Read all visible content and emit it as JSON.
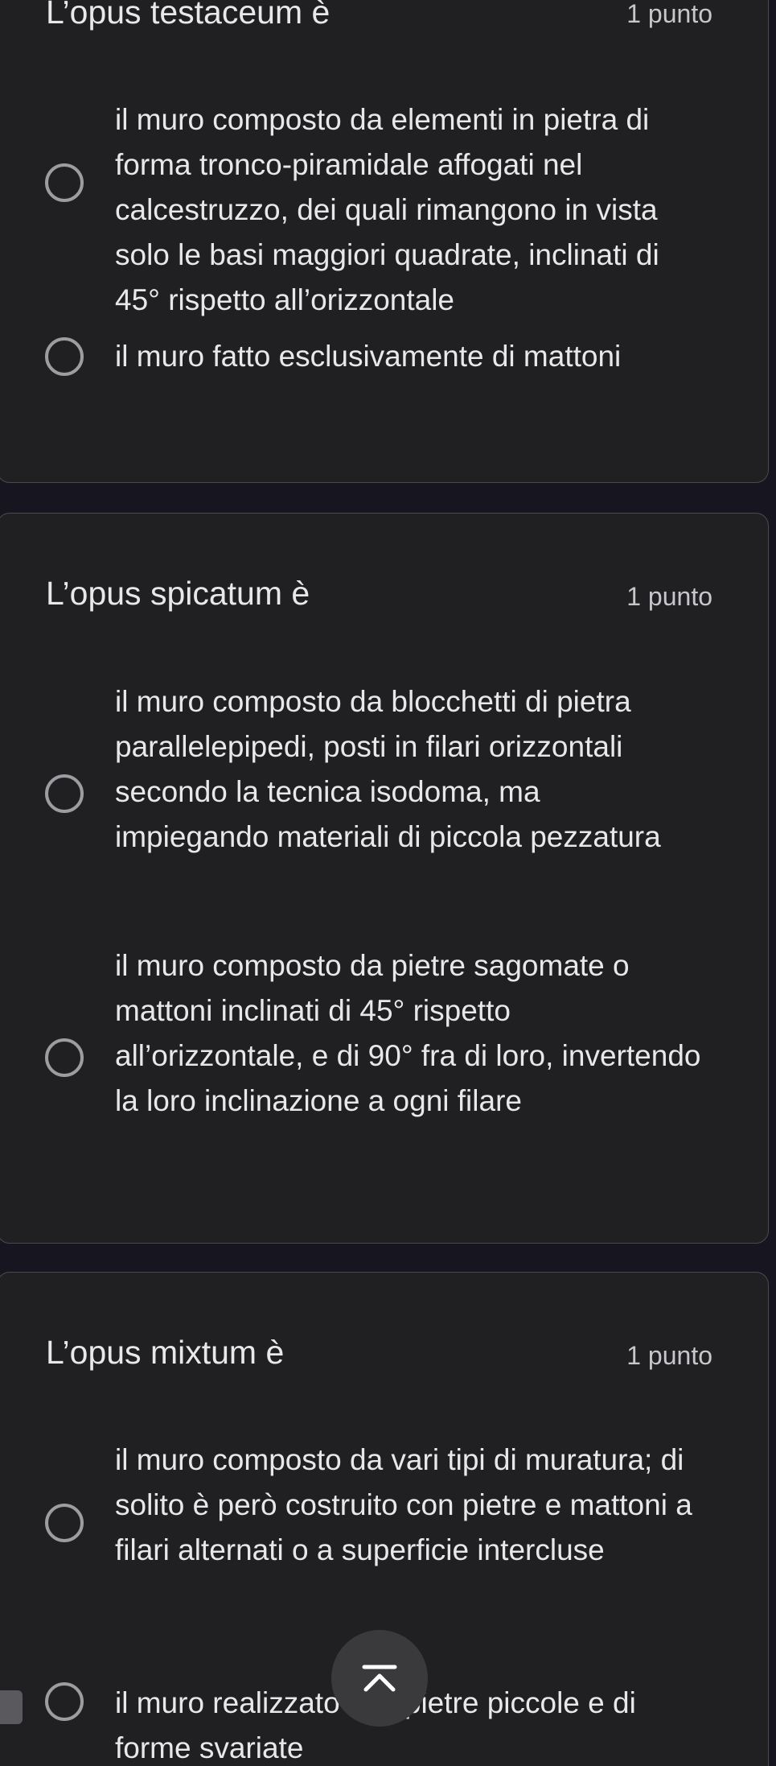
{
  "questions": [
    {
      "title": "L’opus testaceum è",
      "points": "1 punto",
      "options": [
        {
          "text": "il muro composto da elementi in pietra di forma tronco-piramidale affogati nel calcestruzzo, dei quali rimangono in vista solo le basi maggiori quadrate, inclinati di 45° rispetto all’orizzontale"
        },
        {
          "text": "il muro fatto esclusivamente di mattoni"
        }
      ]
    },
    {
      "title": "L’opus spicatum è",
      "points": "1 punto",
      "options": [
        {
          "text": "il muro composto da blocchetti di pietra parallelepipedi, posti in filari orizzontali secondo la tecnica isodoma, ma impiegando materiali di piccola pezzatura"
        },
        {
          "text": "il muro composto da pietre sagomate o mattoni inclinati di 45° rispetto all’orizzontale, e di 90° fra di loro, invertendo la loro inclinazione a ogni filare"
        }
      ]
    },
    {
      "title": "L’opus mixtum è",
      "points": "1 punto",
      "options": [
        {
          "text": "il muro composto da vari tipi di muratura; di solito è però costruito con pietre e mattoni a filari alternati o a superficie intercluse"
        },
        {
          "text": "il muro realizzato con pietre piccole e di forme svariate"
        }
      ]
    }
  ],
  "fab": {
    "icon": "scroll-to-top-icon"
  },
  "colors": {
    "background": "#171520",
    "card": "#202022",
    "border": "#4a4a4f",
    "text": "#e8e8ea"
  }
}
